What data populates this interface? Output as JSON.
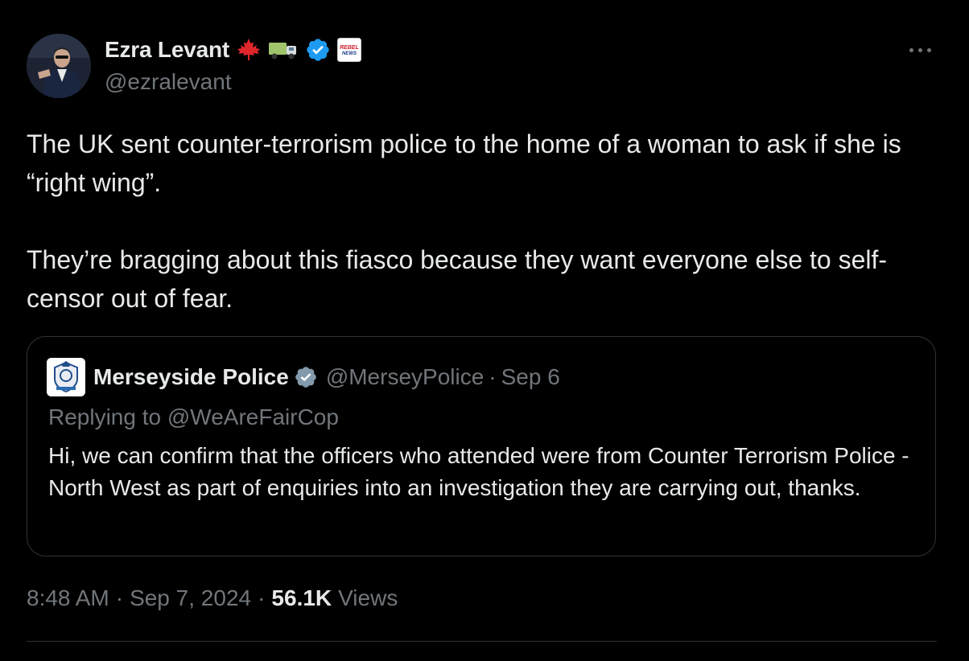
{
  "author": {
    "display_name": "Ezra Levant",
    "handle": "@ezralevant",
    "badge_icons": [
      "maple-leaf-icon",
      "truck-icon",
      "verified-badge-icon",
      "rebel-news-icon"
    ],
    "badge_label": "REBEL NEWS"
  },
  "tweet": {
    "paragraphs": [
      "The UK sent counter-terrorism police to the home of a woman to ask if she is “right wing”.",
      "They’re bragging about this fiasco because they want everyone else to self-censor out of fear."
    ]
  },
  "quote": {
    "display_name": "Merseyside Police",
    "handle": "@MerseyPolice",
    "separator": "·",
    "date": "Sep 6",
    "replying_to": "Replying to @WeAreFairCop",
    "text": "Hi, we can confirm that the officers who attended were from Counter Terrorism Police - North West as part of enquiries into an investigation they are carrying out, thanks."
  },
  "meta": {
    "time": "8:48 AM",
    "separator": "·",
    "date": "Sep 7, 2024",
    "views_count": "56.1K",
    "views_label": "Views"
  },
  "colors": {
    "background": "#000000",
    "text_primary": "#e7e9ea",
    "text_secondary": "#71767b",
    "border": "#2f3336",
    "verified_blue": "#1d9bf0",
    "verified_gray": "#829aab"
  }
}
